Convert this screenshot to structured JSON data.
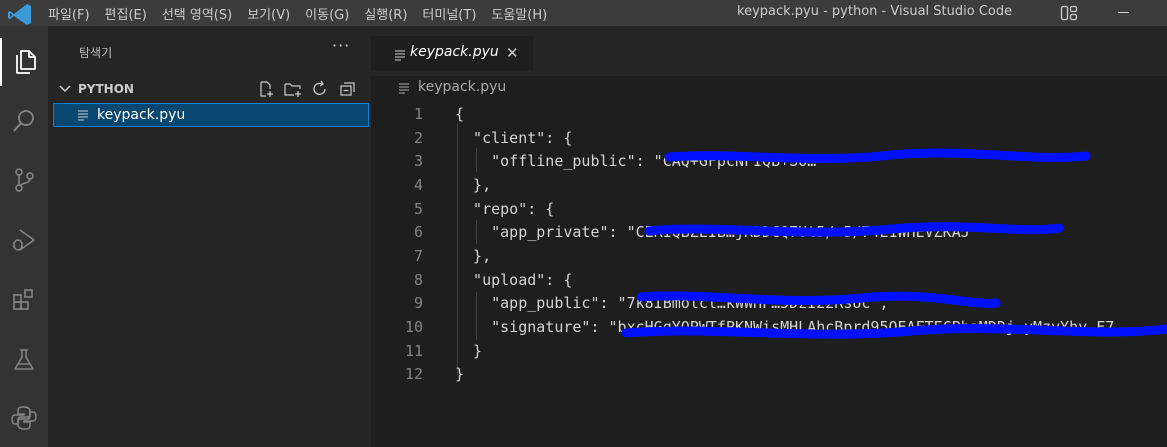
{
  "menu": [
    "파일(F)",
    "편집(E)",
    "선택 영역(S)",
    "보기(V)",
    "이동(G)",
    "실행(R)",
    "터미널(T)",
    "도움말(H)"
  ],
  "window_title": "keypack.pyu - python - Visual Studio Code",
  "activity_bar": [
    "explorer-icon",
    "search-icon",
    "source-control-icon",
    "run-debug-icon",
    "extensions-icon",
    "testing-icon",
    "python-icon"
  ],
  "sidebar": {
    "title": "탐색기",
    "more": "···",
    "section": "PYTHON",
    "files": [
      {
        "name": "keypack.pyu",
        "selected": true
      }
    ]
  },
  "tab": {
    "label": "keypack.pyu",
    "close": "✕"
  },
  "breadcrumb": "keypack.pyu",
  "editor": {
    "lines": [
      "{",
      "  \"client\": {",
      "    \"offline_public\": \"CAQ+GFpcNFIQB+So…\"",
      "  },",
      "  \"repo\": {",
      "    \"app_private\": \"CERIQBZEIB…jRDDCQ7Ut5/+5/74E1WHEVZKAJ\"",
      "  },",
      "  \"upload\": {",
      "    \"app_public\": \"7k8IBmolcl…kWWHF…5DzI22RsUc\",",
      "    \"signature\": \"bxcHGqYOPWTfPKNWisMHLAhcBprd95QEAFTECBbaMDDj…yMzyYhy.F7",
      "  }",
      "}"
    ]
  },
  "colors": {
    "titlebar": "#3c3c3c",
    "activitybar": "#333333",
    "sidebar": "#252526",
    "editor": "#1e1e1e",
    "selection": "#094771",
    "redaction": "#0010ff"
  }
}
